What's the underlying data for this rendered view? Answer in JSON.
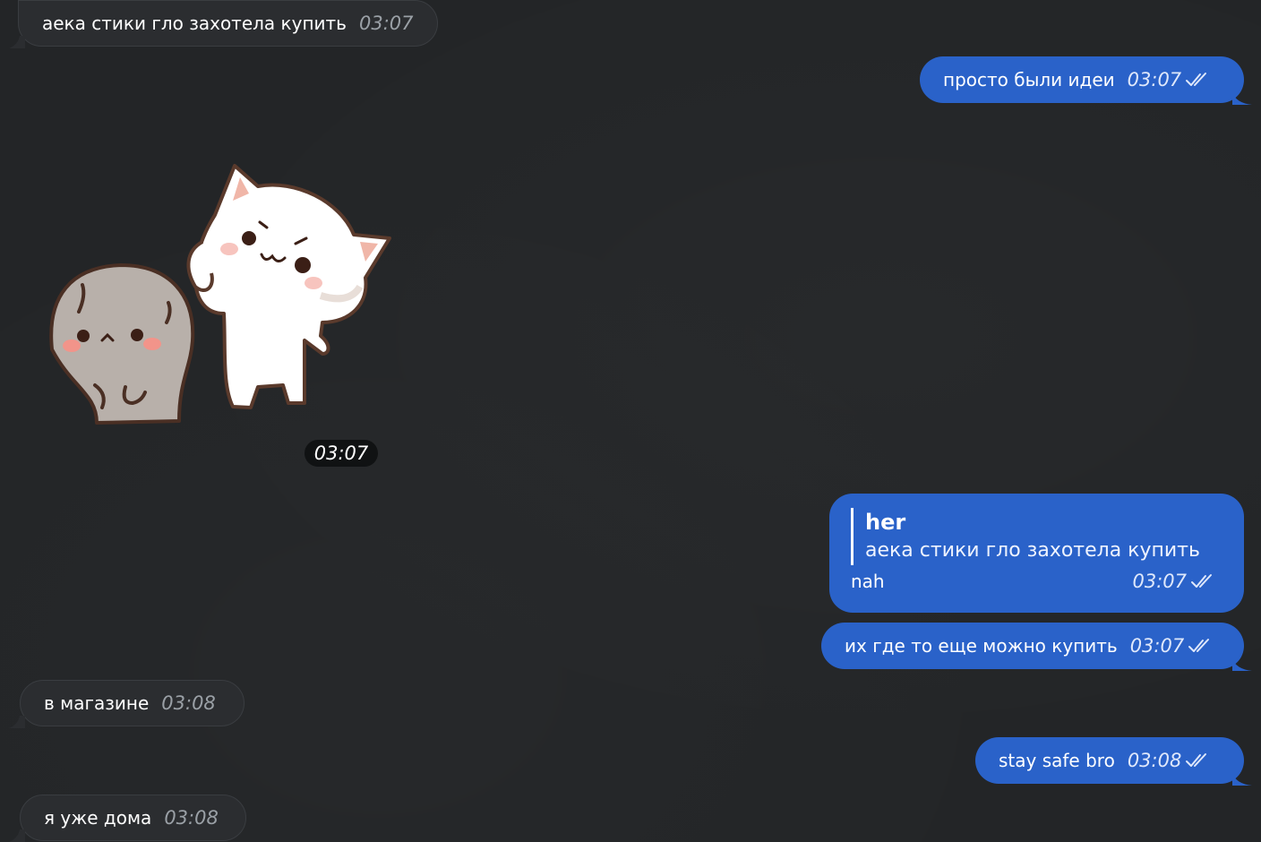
{
  "messages": [
    {
      "id": "m1",
      "direction": "in",
      "text": "аека стики гло захотела купить",
      "time": "03:07"
    },
    {
      "id": "m2",
      "direction": "out",
      "text": "просто были идеи",
      "time": "03:07",
      "read": true
    },
    {
      "id": "m3",
      "direction": "in",
      "type": "sticker",
      "sticker": "cats-sticker",
      "time": "03:07"
    },
    {
      "id": "m4",
      "direction": "out",
      "type": "reply",
      "reply_author": "her",
      "reply_text": "аека стики гло захотела купить",
      "text": "nah",
      "time": "03:07",
      "read": true
    },
    {
      "id": "m5",
      "direction": "out",
      "text": "их где то еще можно купить",
      "time": "03:07",
      "read": true
    },
    {
      "id": "m6",
      "direction": "in",
      "text": "в магазине",
      "time": "03:08"
    },
    {
      "id": "m7",
      "direction": "out",
      "text": "stay safe bro",
      "time": "03:08",
      "read": true
    },
    {
      "id": "m8",
      "direction": "in",
      "text": "я уже дома",
      "time": "03:08"
    }
  ],
  "icons": {
    "read_receipt": "double-check-icon"
  },
  "colors": {
    "background": "#232527",
    "incoming_bubble": "#2b2d30",
    "outgoing_bubble": "#2a62c9",
    "timestamp_in": "#9aa0a6"
  }
}
